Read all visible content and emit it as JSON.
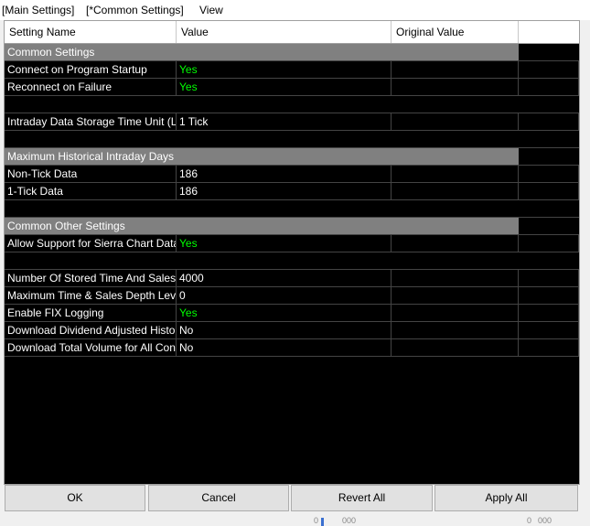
{
  "menubar": {
    "items": [
      "[Main Settings]",
      "[*Common Settings]",
      "View"
    ]
  },
  "grid": {
    "columns": [
      "Setting Name",
      "Value",
      "Original Value"
    ],
    "rows": [
      {
        "kind": "section",
        "name": "Common Settings"
      },
      {
        "kind": "setting",
        "name": "Connect on Program Startup",
        "value": "Yes",
        "original": ""
      },
      {
        "kind": "setting",
        "name": "Reconnect on Failure",
        "value": "Yes",
        "original": ""
      },
      {
        "kind": "spacer"
      },
      {
        "kind": "setting",
        "name": "Intraday Data Storage Time Unit (Li",
        "value": "1 Tick",
        "original": ""
      },
      {
        "kind": "spacer"
      },
      {
        "kind": "section",
        "name": "Maximum Historical Intraday Days"
      },
      {
        "kind": "setting",
        "name": "Non-Tick Data",
        "value": "186",
        "original": ""
      },
      {
        "kind": "setting",
        "name": "1-Tick Data",
        "value": "186",
        "original": ""
      },
      {
        "kind": "spacer"
      },
      {
        "kind": "section",
        "name": "Common Other Settings"
      },
      {
        "kind": "setting",
        "name": "Allow Support for Sierra Chart Data",
        "value": "Yes",
        "original": ""
      },
      {
        "kind": "spacer"
      },
      {
        "kind": "setting",
        "name": "Number Of Stored Time And Sales",
        "value": "4000",
        "original": ""
      },
      {
        "kind": "setting",
        "name": "Maximum Time & Sales Depth Lev",
        "value": "0",
        "original": ""
      },
      {
        "kind": "setting",
        "name": "Enable FIX Logging",
        "value": "Yes",
        "original": ""
      },
      {
        "kind": "setting",
        "name": "Download Dividend Adjusted Histo",
        "value": "No",
        "original": ""
      },
      {
        "kind": "setting",
        "name": "Download Total Volume for All Con",
        "value": "No",
        "original": ""
      }
    ]
  },
  "buttons": {
    "ok": "OK",
    "cancel": "Cancel",
    "revert_all": "Revert All",
    "apply_all": "Apply All"
  },
  "bottom_strip": {
    "labels": [
      "0",
      "000",
      "0",
      "000"
    ]
  },
  "colors": {
    "grid_background": "#000000",
    "section_header": "#808080",
    "yes_value": "#00ff00",
    "text": "#ffffff"
  }
}
